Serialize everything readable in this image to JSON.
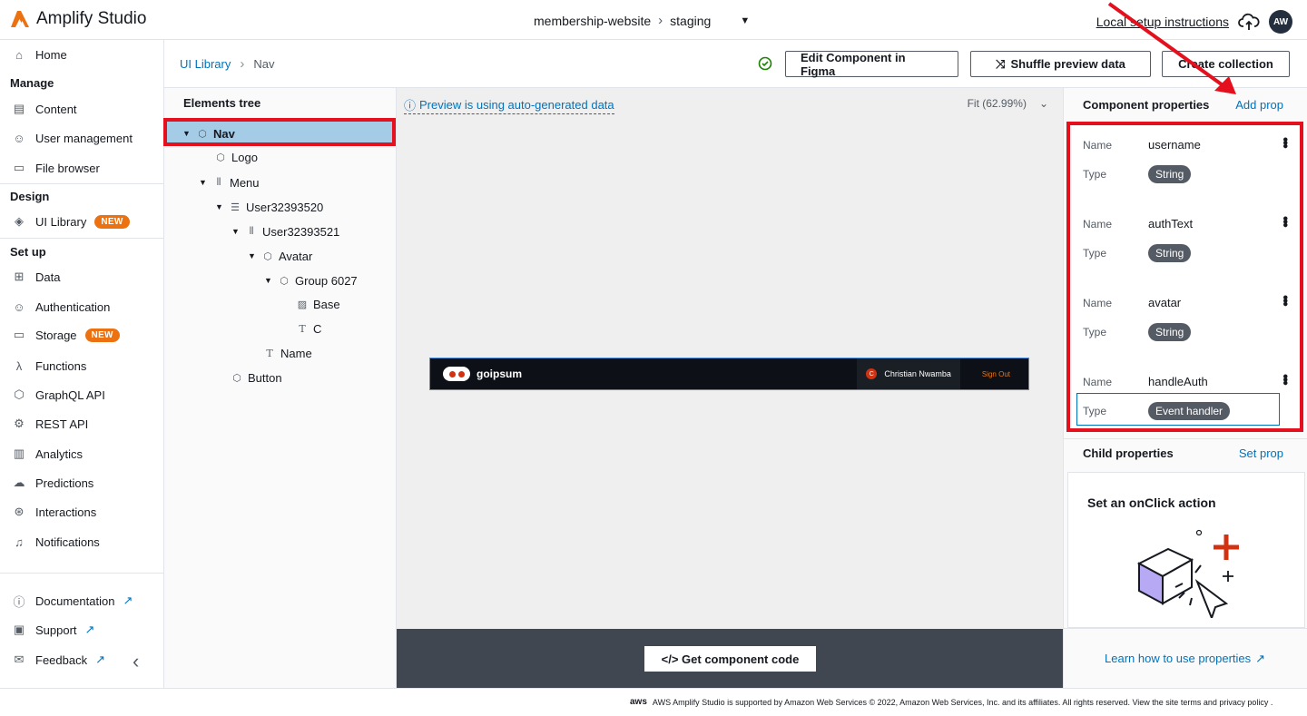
{
  "app": {
    "name": "Amplify Studio",
    "brand_color": "#ec7211"
  },
  "topbar": {
    "app_name": "membership-website",
    "env": "staging",
    "setup_link": "Local setup instructions",
    "user_initials": "AW"
  },
  "sidebar": {
    "home": "Home",
    "manage_head": "Manage",
    "manage": [
      "Content",
      "User management",
      "File browser"
    ],
    "design_head": "Design",
    "ui_library": "UI Library",
    "new_badge": "NEW",
    "setup_head": "Set up",
    "setup": [
      "Data",
      "Authentication",
      "Storage",
      "Functions",
      "GraphQL API",
      "REST API",
      "Analytics",
      "Predictions",
      "Interactions",
      "Notifications"
    ],
    "bottom": [
      "Documentation",
      "Support",
      "Feedback"
    ]
  },
  "breadcrumb": {
    "root": "UI Library",
    "current": "Nav"
  },
  "toolbar": {
    "edit_figma": "Edit Component in Figma",
    "shuffle": "Shuffle preview data",
    "create_collection": "Create collection"
  },
  "tree": {
    "title": "Elements tree",
    "nodes": [
      "Nav",
      "Logo",
      "Menu",
      "User32393520",
      "User32393521",
      "Avatar",
      "Group 6027",
      "Base",
      "C",
      "Name",
      "Button"
    ]
  },
  "canvas": {
    "preview_note": "Preview is using auto-generated data",
    "fit": "Fit (62.99%)"
  },
  "preview": {
    "logo_text": "goipsum",
    "avatar_letter": "C",
    "user_name": "Christian Nwamba",
    "sign_out": "Sign Out"
  },
  "code_button": "</> Get component code",
  "component_props": {
    "title": "Component properties",
    "add_prop": "Add prop",
    "name_label": "Name",
    "type_label": "Type",
    "items": [
      {
        "name": "username",
        "type": "String"
      },
      {
        "name": "authText",
        "type": "String"
      },
      {
        "name": "avatar",
        "type": "String"
      },
      {
        "name": "handleAuth",
        "type": "Event handler"
      }
    ]
  },
  "child_props": {
    "title": "Child properties",
    "set_prop": "Set prop",
    "card_title": "Set an onClick action"
  },
  "learn_link": "Learn how to use properties",
  "footer": {
    "aws": "aws",
    "text": "AWS Amplify Studio is supported by Amazon Web Services © 2022, Amazon Web Services, Inc. and its affiliates. All rights reserved. View the site terms and privacy policy ."
  }
}
